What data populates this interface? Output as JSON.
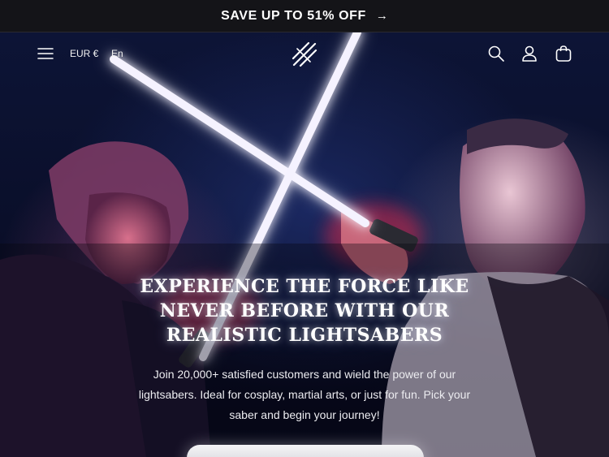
{
  "announcement": {
    "text": "SAVE UP TO 51% OFF",
    "arrow_icon": "arrow-right-icon"
  },
  "header": {
    "menu_icon": "hamburger-menu-icon",
    "currency": "EUR €",
    "language": "En",
    "logo_icon": "crossed-sabers-logo",
    "search_icon": "search-icon",
    "account_icon": "user-icon",
    "cart_icon": "shopping-bag-icon"
  },
  "hero": {
    "headline": "EXPERIENCE THE FORCE LIKE NEVER BEFORE WITH OUR REALISTIC LIGHTSABERS",
    "subtext": "Join 20,000+ satisfied customers and wield the power of our lightsabers. Ideal for cosplay, martial arts, or just for fun. Pick your saber and begin your journey!",
    "accent_colors": {
      "blade_white": "#f5f2ff",
      "red_glow": "#ff3b52",
      "blue_glow": "#4a6cff",
      "background": "#0b0f2a"
    }
  }
}
